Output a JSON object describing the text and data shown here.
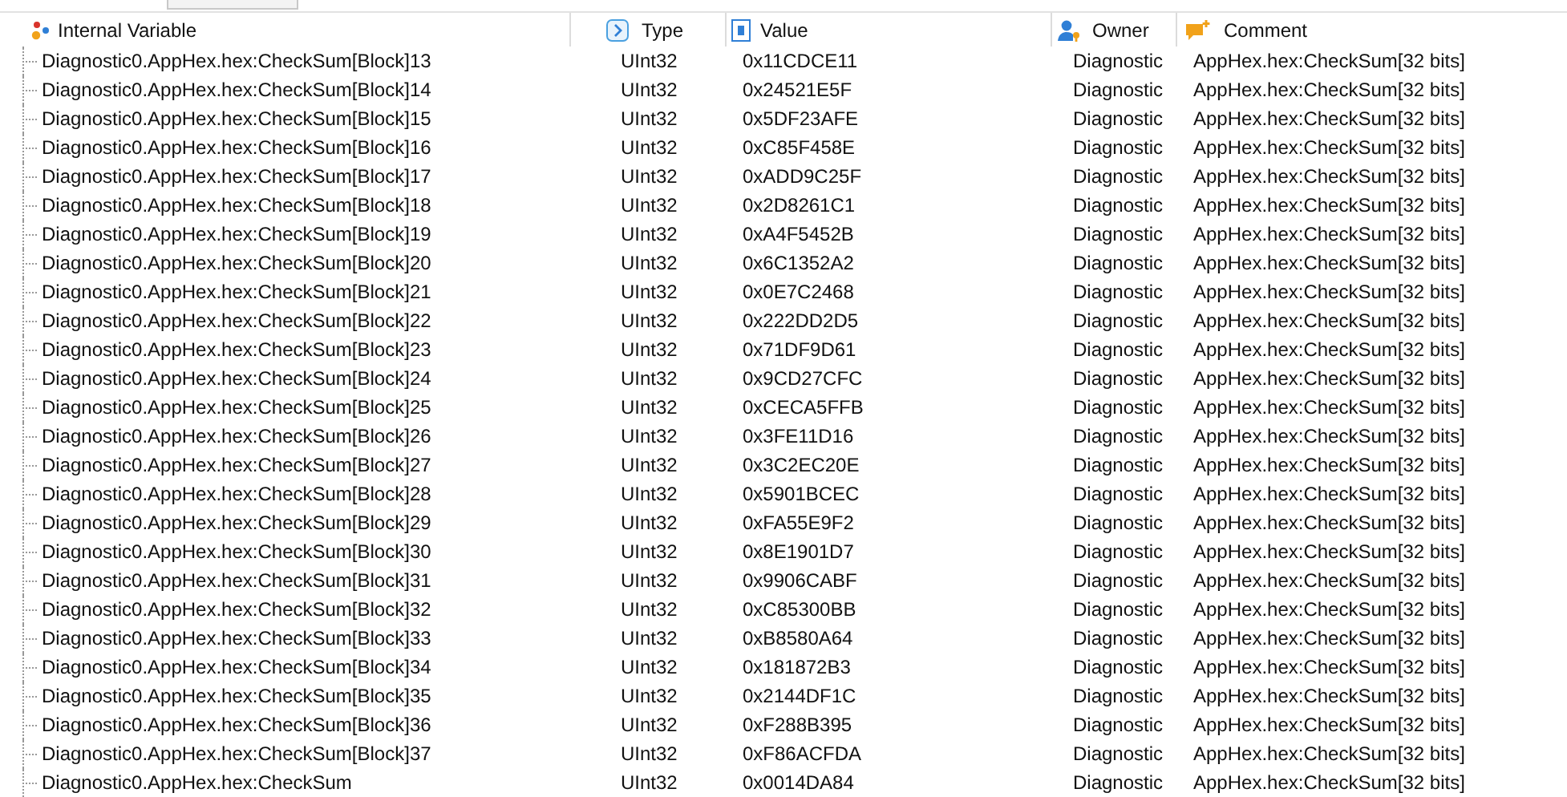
{
  "columns": [
    {
      "kind": "name",
      "label": "Internal Variable"
    },
    {
      "kind": "type",
      "label": "Type"
    },
    {
      "kind": "value",
      "label": "Value"
    },
    {
      "kind": "owner",
      "label": "Owner"
    },
    {
      "kind": "comment",
      "label": "Comment"
    }
  ],
  "rows": [
    {
      "name": "Diagnostic0.AppHex.hex:CheckSum[Block]13",
      "type": "UInt32",
      "value": "0x11CDCE11",
      "owner": "Diagnostic",
      "comment": "AppHex.hex:CheckSum[32 bits]"
    },
    {
      "name": "Diagnostic0.AppHex.hex:CheckSum[Block]14",
      "type": "UInt32",
      "value": "0x24521E5F",
      "owner": "Diagnostic",
      "comment": "AppHex.hex:CheckSum[32 bits]"
    },
    {
      "name": "Diagnostic0.AppHex.hex:CheckSum[Block]15",
      "type": "UInt32",
      "value": "0x5DF23AFE",
      "owner": "Diagnostic",
      "comment": "AppHex.hex:CheckSum[32 bits]"
    },
    {
      "name": "Diagnostic0.AppHex.hex:CheckSum[Block]16",
      "type": "UInt32",
      "value": "0xC85F458E",
      "owner": "Diagnostic",
      "comment": "AppHex.hex:CheckSum[32 bits]"
    },
    {
      "name": "Diagnostic0.AppHex.hex:CheckSum[Block]17",
      "type": "UInt32",
      "value": "0xADD9C25F",
      "owner": "Diagnostic",
      "comment": "AppHex.hex:CheckSum[32 bits]"
    },
    {
      "name": "Diagnostic0.AppHex.hex:CheckSum[Block]18",
      "type": "UInt32",
      "value": "0x2D8261C1",
      "owner": "Diagnostic",
      "comment": "AppHex.hex:CheckSum[32 bits]"
    },
    {
      "name": "Diagnostic0.AppHex.hex:CheckSum[Block]19",
      "type": "UInt32",
      "value": "0xA4F5452B",
      "owner": "Diagnostic",
      "comment": "AppHex.hex:CheckSum[32 bits]"
    },
    {
      "name": "Diagnostic0.AppHex.hex:CheckSum[Block]20",
      "type": "UInt32",
      "value": "0x6C1352A2",
      "owner": "Diagnostic",
      "comment": "AppHex.hex:CheckSum[32 bits]"
    },
    {
      "name": "Diagnostic0.AppHex.hex:CheckSum[Block]21",
      "type": "UInt32",
      "value": "0x0E7C2468",
      "owner": "Diagnostic",
      "comment": "AppHex.hex:CheckSum[32 bits]"
    },
    {
      "name": "Diagnostic0.AppHex.hex:CheckSum[Block]22",
      "type": "UInt32",
      "value": "0x222DD2D5",
      "owner": "Diagnostic",
      "comment": "AppHex.hex:CheckSum[32 bits]"
    },
    {
      "name": "Diagnostic0.AppHex.hex:CheckSum[Block]23",
      "type": "UInt32",
      "value": "0x71DF9D61",
      "owner": "Diagnostic",
      "comment": "AppHex.hex:CheckSum[32 bits]"
    },
    {
      "name": "Diagnostic0.AppHex.hex:CheckSum[Block]24",
      "type": "UInt32",
      "value": "0x9CD27CFC",
      "owner": "Diagnostic",
      "comment": "AppHex.hex:CheckSum[32 bits]"
    },
    {
      "name": "Diagnostic0.AppHex.hex:CheckSum[Block]25",
      "type": "UInt32",
      "value": "0xCECA5FFB",
      "owner": "Diagnostic",
      "comment": "AppHex.hex:CheckSum[32 bits]"
    },
    {
      "name": "Diagnostic0.AppHex.hex:CheckSum[Block]26",
      "type": "UInt32",
      "value": "0x3FE11D16",
      "owner": "Diagnostic",
      "comment": "AppHex.hex:CheckSum[32 bits]"
    },
    {
      "name": "Diagnostic0.AppHex.hex:CheckSum[Block]27",
      "type": "UInt32",
      "value": "0x3C2EC20E",
      "owner": "Diagnostic",
      "comment": "AppHex.hex:CheckSum[32 bits]"
    },
    {
      "name": "Diagnostic0.AppHex.hex:CheckSum[Block]28",
      "type": "UInt32",
      "value": "0x5901BCEC",
      "owner": "Diagnostic",
      "comment": "AppHex.hex:CheckSum[32 bits]"
    },
    {
      "name": "Diagnostic0.AppHex.hex:CheckSum[Block]29",
      "type": "UInt32",
      "value": "0xFA55E9F2",
      "owner": "Diagnostic",
      "comment": "AppHex.hex:CheckSum[32 bits]"
    },
    {
      "name": "Diagnostic0.AppHex.hex:CheckSum[Block]30",
      "type": "UInt32",
      "value": "0x8E1901D7",
      "owner": "Diagnostic",
      "comment": "AppHex.hex:CheckSum[32 bits]"
    },
    {
      "name": "Diagnostic0.AppHex.hex:CheckSum[Block]31",
      "type": "UInt32",
      "value": "0x9906CABF",
      "owner": "Diagnostic",
      "comment": "AppHex.hex:CheckSum[32 bits]"
    },
    {
      "name": "Diagnostic0.AppHex.hex:CheckSum[Block]32",
      "type": "UInt32",
      "value": "0xC85300BB",
      "owner": "Diagnostic",
      "comment": "AppHex.hex:CheckSum[32 bits]"
    },
    {
      "name": "Diagnostic0.AppHex.hex:CheckSum[Block]33",
      "type": "UInt32",
      "value": "0xB8580A64",
      "owner": "Diagnostic",
      "comment": "AppHex.hex:CheckSum[32 bits]"
    },
    {
      "name": "Diagnostic0.AppHex.hex:CheckSum[Block]34",
      "type": "UInt32",
      "value": "0x181872B3",
      "owner": "Diagnostic",
      "comment": "AppHex.hex:CheckSum[32 bits]"
    },
    {
      "name": "Diagnostic0.AppHex.hex:CheckSum[Block]35",
      "type": "UInt32",
      "value": "0x2144DF1C",
      "owner": "Diagnostic",
      "comment": "AppHex.hex:CheckSum[32 bits]"
    },
    {
      "name": "Diagnostic0.AppHex.hex:CheckSum[Block]36",
      "type": "UInt32",
      "value": "0xF288B395",
      "owner": "Diagnostic",
      "comment": "AppHex.hex:CheckSum[32 bits]"
    },
    {
      "name": "Diagnostic0.AppHex.hex:CheckSum[Block]37",
      "type": "UInt32",
      "value": "0xF86ACFDA",
      "owner": "Diagnostic",
      "comment": "AppHex.hex:CheckSum[32 bits]"
    },
    {
      "name": "Diagnostic0.AppHex.hex:CheckSum",
      "type": "UInt32",
      "value": "0x0014DA84",
      "owner": "Diagnostic",
      "comment": "AppHex.hex:CheckSum[32 bits]"
    }
  ]
}
